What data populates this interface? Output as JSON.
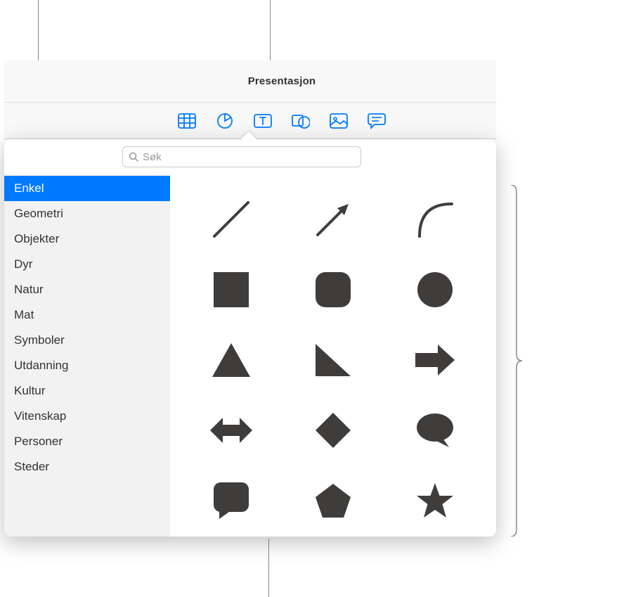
{
  "title": "Presentasjon",
  "toolbar": {
    "table": "table-icon",
    "chart": "chart-icon",
    "text": "text-icon",
    "shape": "shape-icon",
    "media": "media-icon",
    "comment": "comment-icon"
  },
  "search": {
    "placeholder": "Søk"
  },
  "sidebar": {
    "items": [
      {
        "label": "Enkel",
        "selected": true
      },
      {
        "label": "Geometri",
        "selected": false
      },
      {
        "label": "Objekter",
        "selected": false
      },
      {
        "label": "Dyr",
        "selected": false
      },
      {
        "label": "Natur",
        "selected": false
      },
      {
        "label": "Mat",
        "selected": false
      },
      {
        "label": "Symboler",
        "selected": false
      },
      {
        "label": "Utdanning",
        "selected": false
      },
      {
        "label": "Kultur",
        "selected": false
      },
      {
        "label": "Vitenskap",
        "selected": false
      },
      {
        "label": "Personer",
        "selected": false
      },
      {
        "label": "Steder",
        "selected": false
      }
    ]
  },
  "shapes": [
    {
      "name": "line"
    },
    {
      "name": "arrow"
    },
    {
      "name": "curve"
    },
    {
      "name": "square"
    },
    {
      "name": "rounded-square"
    },
    {
      "name": "circle"
    },
    {
      "name": "triangle"
    },
    {
      "name": "right-triangle"
    },
    {
      "name": "right-arrow-block"
    },
    {
      "name": "double-arrow-block"
    },
    {
      "name": "diamond"
    },
    {
      "name": "speech-bubble"
    },
    {
      "name": "square-callout"
    },
    {
      "name": "pentagon"
    },
    {
      "name": "star"
    }
  ],
  "colors": {
    "accent": "#007aff",
    "shape_fill": "#3f3c3c"
  }
}
